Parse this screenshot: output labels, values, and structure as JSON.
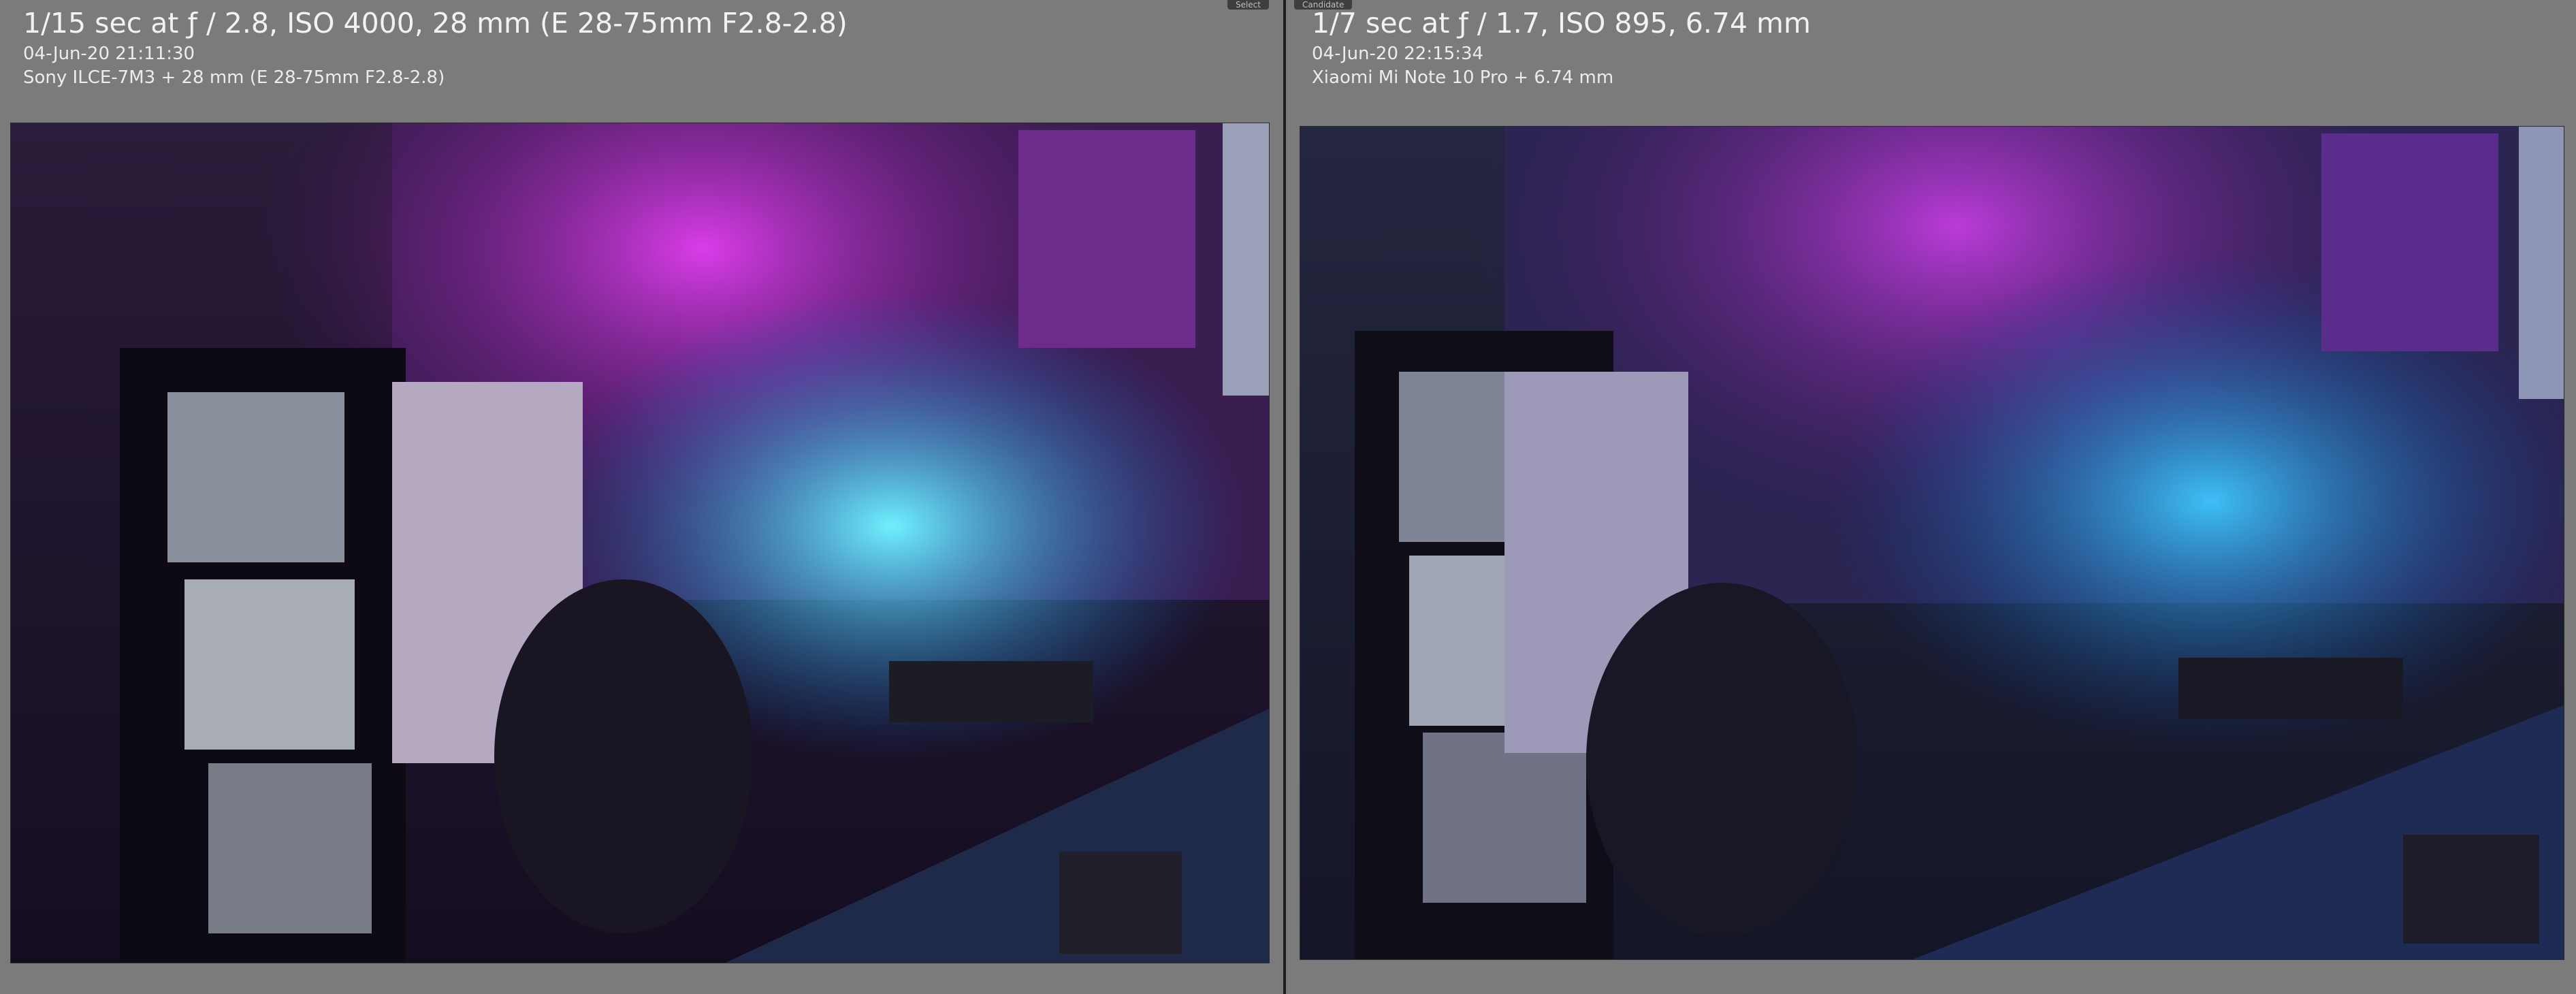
{
  "left": {
    "tag": "Select",
    "exposure": "1/15 sec at ƒ / 2.8, ISO 4000, 28 mm (E 28-75mm F2.8-2.8)",
    "datetime": "04-Jun-20 21:11:30",
    "camera": "Sony ILCE-7M3 + 28 mm (E 28-75mm F2.8-2.8)",
    "photo_icon": "room-photo-icon"
  },
  "right": {
    "tag": "Candidate",
    "exposure": "1/7 sec at ƒ / 1.7, ISO 895, 6.74 mm",
    "datetime": "04-Jun-20 22:15:34",
    "camera": "Xiaomi Mi Note 10 Pro + 6.74 mm",
    "photo_icon": "room-photo-icon"
  },
  "colors": {
    "background": "#7b7b7b",
    "divider": "#1f1f1f",
    "text": "#f2f2f2",
    "magenta_light": "#d42be0",
    "cyan_light": "#27d3ff"
  }
}
